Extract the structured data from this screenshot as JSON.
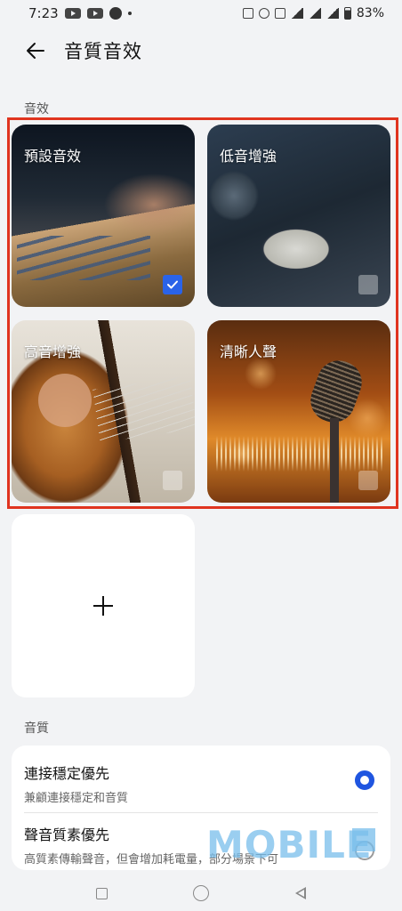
{
  "status_bar": {
    "time": "7:23",
    "battery": "83%"
  },
  "header": {
    "title": "音質音效"
  },
  "effects_section": {
    "label": "音效",
    "cards": [
      {
        "label": "預設音效",
        "selected": true,
        "icon": "mixing-console-image"
      },
      {
        "label": "低音增強",
        "selected": false,
        "icon": "drum-kit-image"
      },
      {
        "label": "高音增強",
        "selected": false,
        "icon": "acoustic-guitar-image"
      },
      {
        "label": "清晰人聲",
        "selected": false,
        "icon": "microphone-image"
      }
    ],
    "add_icon": "plus-icon"
  },
  "quality_section": {
    "label": "音質",
    "options": [
      {
        "title": "連接穩定優先",
        "subtitle": "兼顧連接穩定和音質",
        "selected": true
      },
      {
        "title": "聲音質素優先",
        "subtitle": "高質素傳輸聲音，但會增加耗電量，部分場景下可",
        "selected": false
      }
    ]
  },
  "watermark": {
    "text": "MOBILE"
  },
  "colors": {
    "accent": "#2a63e8",
    "highlight": "#e0341f",
    "background": "#f2f3f5"
  }
}
